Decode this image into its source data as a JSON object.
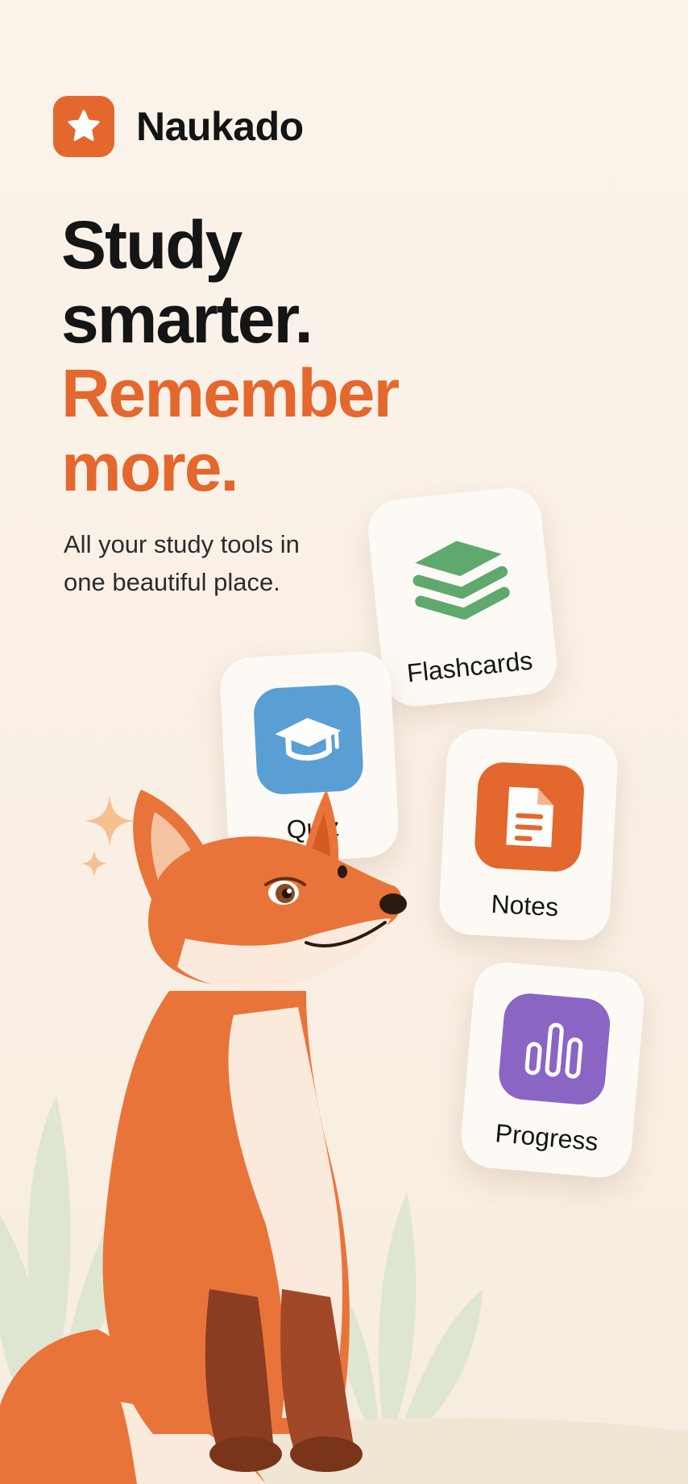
{
  "brand": {
    "name": "Naukado"
  },
  "hero": {
    "line1": "Study",
    "line2": "smarter.",
    "line3": "Remember",
    "line4": "more."
  },
  "subtitle": "All your study tools in one beautiful place.",
  "tools": [
    {
      "label": "Flashcards",
      "icon": "stacked-cards-icon",
      "color": "#5fa86e"
    },
    {
      "label": "Quiz",
      "icon": "graduation-cap-icon",
      "color": "#5a9fd4"
    },
    {
      "label": "Notes",
      "icon": "document-icon",
      "color": "#e4672d"
    },
    {
      "label": "Progress",
      "icon": "bar-chart-icon",
      "color": "#8a65c4"
    }
  ],
  "colors": {
    "accent": "#e4672d",
    "background": "#faf1e7"
  }
}
